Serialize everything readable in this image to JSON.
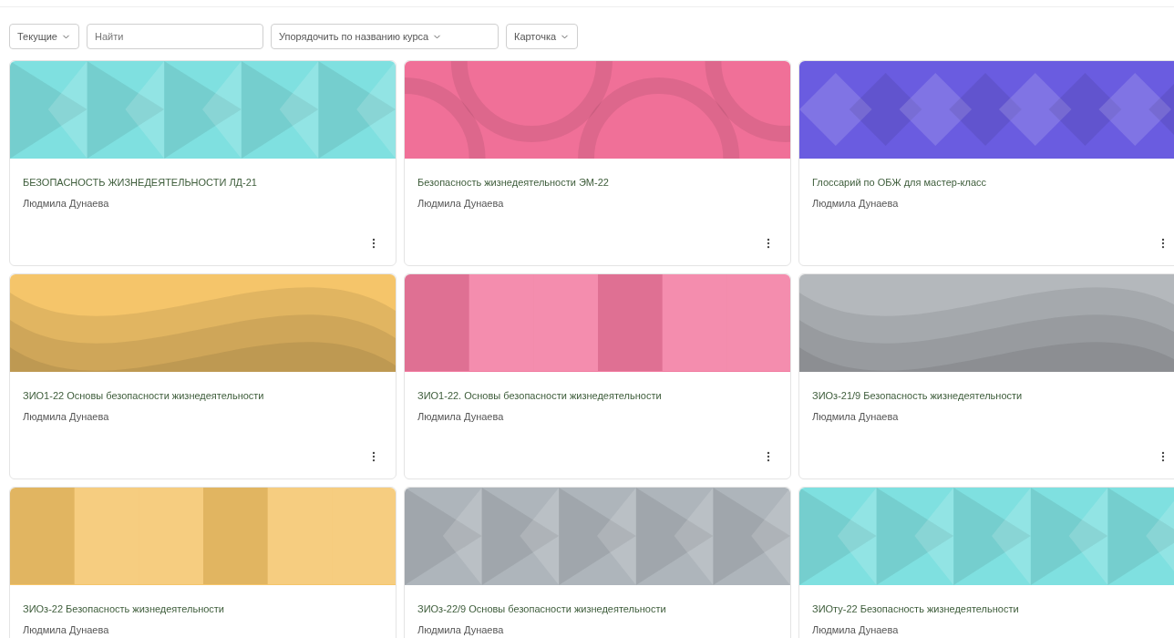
{
  "filters": {
    "grouping": {
      "label": "Текущие"
    },
    "search": {
      "placeholder": "Найти"
    },
    "sort": {
      "label": "Упорядочить по названию курса"
    },
    "view": {
      "label": "Карточка"
    }
  },
  "courses": [
    {
      "title": "БЕЗОПАСНОСТЬ ЖИЗНЕДЕЯТЕЛЬНОСТИ ЛД-21",
      "author": "Людмила Дунаева",
      "color": "#7fe0e0",
      "kind": "triangles"
    },
    {
      "title": "Безопасность жизнедеятельности ЭМ-22",
      "author": "Людмила Дунаева",
      "color": "#f07098",
      "kind": "circles"
    },
    {
      "title": "Глоссарий по ОБЖ для мастер-класс",
      "author": "Людмила Дунаева",
      "color": "#6a5ce0",
      "kind": "diamonds"
    },
    {
      "title": "ЗИО1-22 Основы безопасности жизнедеятельности",
      "author": "Людмила Дунаева",
      "color": "#f5c56a",
      "kind": "waves"
    },
    {
      "title": "ЗИО1-22. Основы безопасности жизнедеятельности",
      "author": "Людмила Дунаева",
      "color": "#f27aa0",
      "kind": "squares"
    },
    {
      "title": "ЗИОз-21/9 Безопасность жизнедеятельности",
      "author": "Людмила Дунаева",
      "color": "#b4b8bc",
      "kind": "waves"
    },
    {
      "title": "ЗИОз-22 Безопасность жизнедеятельности",
      "author": "Людмила Дунаева",
      "color": "#f5c56a",
      "kind": "squares"
    },
    {
      "title": "ЗИОз-22/9 Основы безопасности жизнедеятельности",
      "author": "Людмила Дунаева",
      "color": "#aeb5bb",
      "kind": "triangles"
    },
    {
      "title": "ЗИОту-22 Безопасность жизнедеятельности",
      "author": "Людмила Дунаева",
      "color": "#7fe0e0",
      "kind": "triangles"
    }
  ]
}
